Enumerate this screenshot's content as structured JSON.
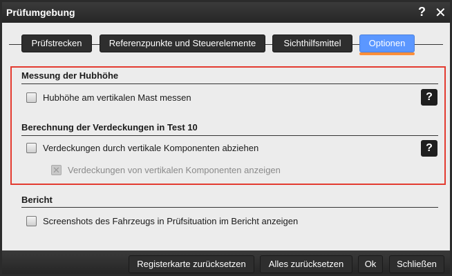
{
  "window": {
    "title": "Prüfumgebung",
    "help_glyph": "?",
    "close_glyph": "✕"
  },
  "tabs": [
    {
      "label": "Prüfstrecken",
      "active": false
    },
    {
      "label": "Referenzpunkte und Steuerelemente",
      "active": false
    },
    {
      "label": "Sichthilfsmittel",
      "active": false
    },
    {
      "label": "Optionen",
      "active": true
    }
  ],
  "sections": {
    "hubhoehe": {
      "heading": "Messung der Hubhöhe",
      "option_label": "Hubhöhe am vertikalen Mast messen",
      "checked": false
    },
    "verdeckungen": {
      "heading": "Berechnung der Verdeckungen in Test 10",
      "option_label": "Verdeckungen durch vertikale Komponenten abziehen",
      "checked": false,
      "sub_option_label": "Verdeckungen von vertikalen Komponenten anzeigen",
      "sub_option_disabled": true
    },
    "bericht": {
      "heading": "Bericht",
      "option_label": "Screenshots des Fahrzeugs in Prüfsituation im Bericht anzeigen",
      "checked": false
    }
  },
  "help_button_glyph": "?",
  "footer": {
    "reset_tab": "Registerkarte zurücksetzen",
    "reset_all": "Alles zurücksetzen",
    "ok": "Ok",
    "close": "Schließen"
  },
  "colors": {
    "accent_tab": "#5b97ff",
    "tab_underline": "#ff8f3a",
    "highlight_border": "#e33a2f",
    "dark_chrome": "#2e2e2e"
  }
}
